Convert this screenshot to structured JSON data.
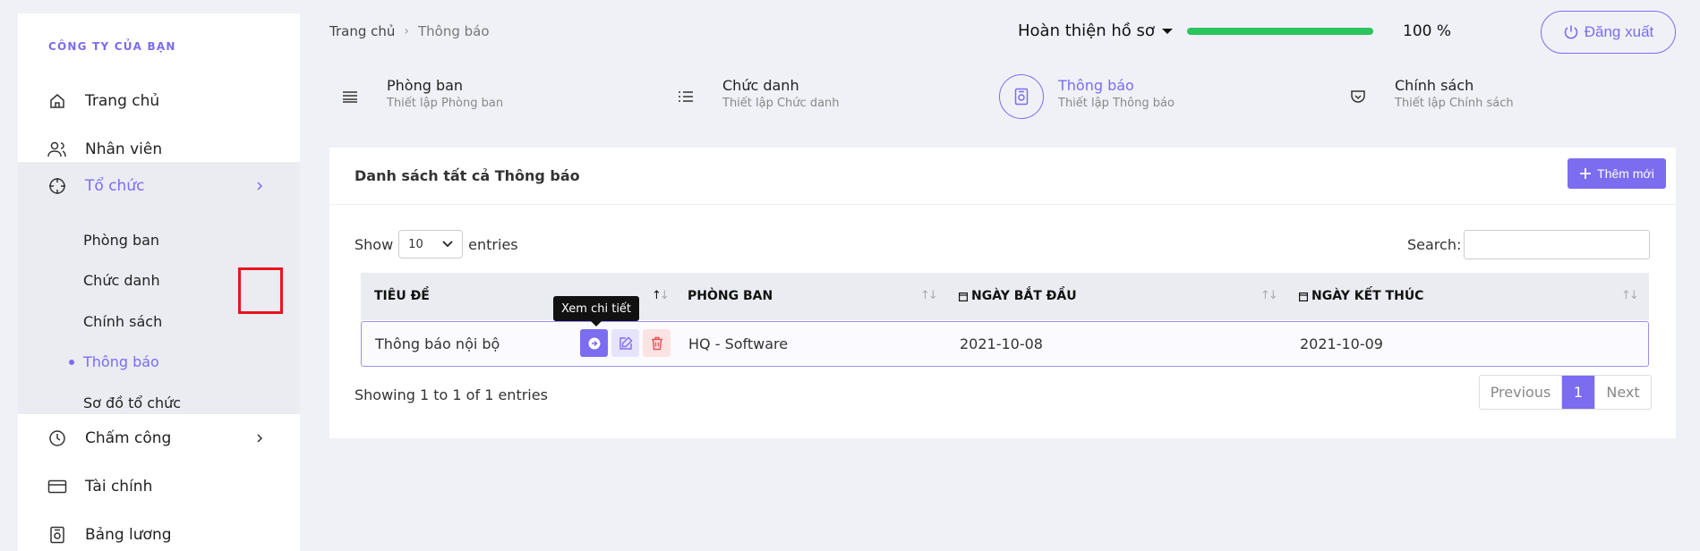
{
  "sidebar": {
    "company": "CÔNG TY CỦA BẠN",
    "items": [
      {
        "label": "Trang chủ"
      },
      {
        "label": "Nhân viên"
      },
      {
        "label": "Tổ chức"
      },
      {
        "label": "Chấm công"
      },
      {
        "label": "Tài chính"
      },
      {
        "label": "Bảng lương"
      }
    ],
    "sub_items": [
      {
        "label": "Phòng ban"
      },
      {
        "label": "Chức danh"
      },
      {
        "label": "Chính sách"
      },
      {
        "label": "Thông báo"
      },
      {
        "label": "Sơ đồ tổ chức"
      }
    ]
  },
  "header": {
    "breadcrumb": {
      "home": "Trang chủ",
      "current": "Thông báo"
    },
    "profile_label": "Hoàn thiện hồ sơ",
    "progress": "100 %",
    "progress_value": 1.0,
    "logout_label": "Đăng xuất"
  },
  "steps": [
    {
      "title": "Phòng ban",
      "subtitle": "Thiết lập Phòng ban"
    },
    {
      "title": "Chức danh",
      "subtitle": "Thiết lập Chức danh"
    },
    {
      "title": "Thông báo",
      "subtitle": "Thiết lập Thông báo"
    },
    {
      "title": "Chính sách",
      "subtitle": "Thiết lập Chính sách"
    }
  ],
  "card": {
    "title": "Danh sách tất cả Thông báo",
    "add_label": "Thêm mới",
    "show_label": "Show",
    "entries_value": "10",
    "entries_label": "entries",
    "search_label": "Search:",
    "search_value": "",
    "columns": [
      "TIÊU ĐỀ",
      "PHÒNG BAN",
      "NGÀY BẮT ĐẦU",
      "NGÀY KẾT THÚC"
    ],
    "rows": [
      {
        "title": "Thông báo nội bộ",
        "department": "HQ - Software",
        "start": "2021-10-08",
        "end": "2021-10-09"
      }
    ],
    "tooltip": "Xem chi tiết",
    "info": "Showing 1 to 1 of 1 entries",
    "pager": {
      "prev": "Previous",
      "page": "1",
      "next": "Next"
    }
  },
  "colors": {
    "accent": "#7b6cf0",
    "progress": "#2bc55e",
    "highlight": "#e8141d"
  }
}
